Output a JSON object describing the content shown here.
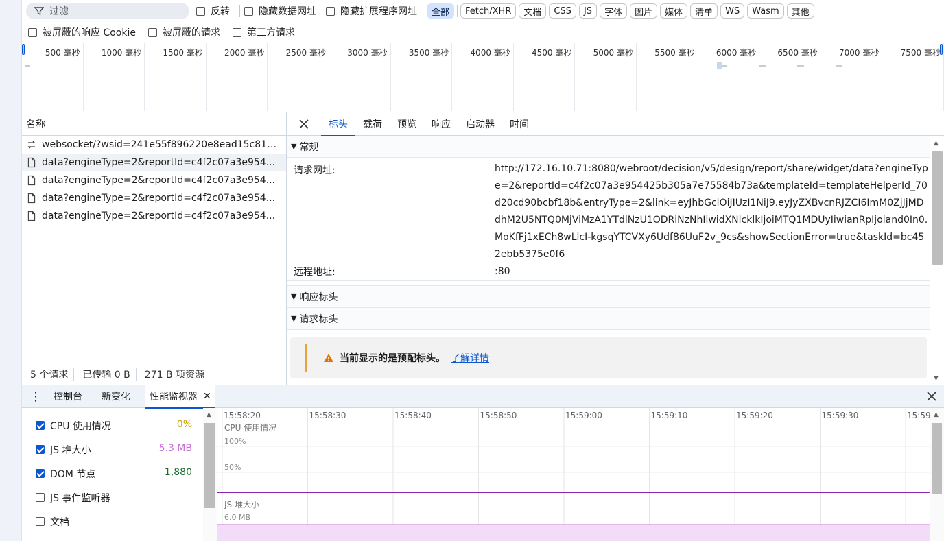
{
  "toolbar": {
    "filter_placeholder": "过滤",
    "invert_label": "反转",
    "hide_data_urls_label": "隐藏数据网址",
    "hide_extension_urls_label": "隐藏扩展程序网址",
    "chips": [
      "全部",
      "Fetch/XHR",
      "文档",
      "CSS",
      "JS",
      "字体",
      "图片",
      "媒体",
      "清单",
      "WS",
      "Wasm",
      "其他"
    ],
    "active_chip": "全部"
  },
  "toolbar2": {
    "blocked_cookies_label": "被屏蔽的响应 Cookie",
    "blocked_requests_label": "被屏蔽的请求",
    "third_party_label": "第三方请求"
  },
  "overview": {
    "ticks": [
      "500 毫秒",
      "1000 毫秒",
      "1500 毫秒",
      "2000 毫秒",
      "2500 毫秒",
      "3000 毫秒",
      "3500 毫秒",
      "4000 毫秒",
      "4500 毫秒",
      "5000 毫秒",
      "5500 毫秒",
      "6000 毫秒",
      "6500 毫秒",
      "7000 毫秒",
      "7500 毫秒"
    ]
  },
  "requests": {
    "column_name": "名称",
    "rows": [
      {
        "name": "websocket/?wsid=241e55f896220e8ead15c815...",
        "type": "websocket"
      },
      {
        "name": "data?engineType=2&reportId=c4f2c07a3e954...",
        "type": "document"
      },
      {
        "name": "data?engineType=2&reportId=c4f2c07a3e954...",
        "type": "document"
      },
      {
        "name": "data?engineType=2&reportId=c4f2c07a3e954...",
        "type": "document"
      },
      {
        "name": "data?engineType=2&reportId=c4f2c07a3e954...",
        "type": "document"
      }
    ],
    "footer": {
      "count": "5 个请求",
      "transferred": "已传输 0 B",
      "resources": "271 B 项资源"
    }
  },
  "detail": {
    "tabs": [
      "标头",
      "载荷",
      "预览",
      "响应",
      "启动器",
      "时间"
    ],
    "active_tab": "标头",
    "general_title": "常规",
    "request_url_label": "请求网址:",
    "request_url": "http://172.16.10.71:8080/webroot/decision/v5/design/report/share/widget/data?engineType=2&reportId=c4f2c07a3e954425b305a7e75584b73a&templateId=templateHelperId_70d20cd90bcbf18b&entryType=2&link=eyJhbGciOiJIUzI1NiJ9.eyJyZXBvcnRJZCI6ImM0ZjJjMDdhM2U5NTQ0MjViMzA1YTdlNzU1ODRiNzNhIiwidXNlcklkIjoiMTQ1MDUyIiwianRpIjoiand0In0.MoKfFj1xECh8wLlcI-kgsqYTCVXy6Udf86UuF2v_9cs&showSectionError=true&taskId=bc452ebb5375e0f6",
    "remote_addr_label": "远程地址:",
    "remote_addr": ":80",
    "response_headers_title": "响应标头",
    "request_headers_title": "请求标头",
    "warning_text": "当前显示的是预配标头。",
    "learn_more": "了解详情"
  },
  "drawer": {
    "tabs": [
      "控制台",
      "新变化",
      "性能监视器"
    ],
    "active_tab": "性能监视器"
  },
  "perf": {
    "metrics": [
      {
        "label": "CPU 使用情况",
        "value": "0%",
        "checked": true,
        "color": "#c9a400"
      },
      {
        "label": "JS 堆大小",
        "value": "5.3 MB",
        "checked": true,
        "color": "#c76fd6"
      },
      {
        "label": "DOM 节点",
        "value": "1,880",
        "checked": true,
        "color": "#1e6b2f"
      },
      {
        "label": "JS 事件监听器",
        "value": "",
        "checked": false,
        "color": "#333333"
      },
      {
        "label": "文档",
        "value": "",
        "checked": false,
        "color": "#333333"
      }
    ],
    "time_ticks": [
      "15:58:20",
      "15:58:30",
      "15:58:40",
      "15:58:50",
      "15:59:00",
      "15:59:10",
      "15:59:20",
      "15:59:30",
      "15:59"
    ],
    "cpu_title": "CPU 使用情况",
    "cpu_100": "100%",
    "cpu_50": "50%",
    "heap_title": "JS 堆大小",
    "heap_max": "6.0 MB",
    "colors": {
      "cpu_line": "#8e24aa",
      "heap_fill": "#f3dcf7",
      "heap_line": "#c76fd6"
    }
  }
}
